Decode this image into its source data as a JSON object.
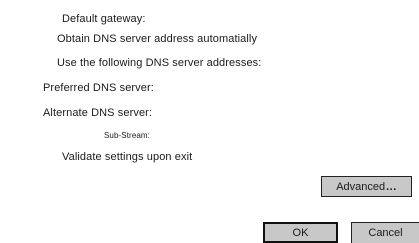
{
  "labels": {
    "default_gateway": "Default gateway:",
    "obtain_dns_auto": "Obtain DNS server address automatially",
    "use_following_dns": "Use the following DNS server addresses:",
    "preferred_dns": "Preferred DNS server:",
    "alternate_dns": "Alternate DNS server:",
    "sub_stream": "Sub-Stream:",
    "validate_on_exit": "Validate settings upon exit"
  },
  "buttons": {
    "advanced_label": "Advanced",
    "advanced_ellipsis": "...",
    "ok_label": "OK",
    "cancel_label": "Cancel"
  },
  "colors": {
    "button_face": "#c8c8c8",
    "background": "#ffffff",
    "text": "#1a1a1a"
  }
}
